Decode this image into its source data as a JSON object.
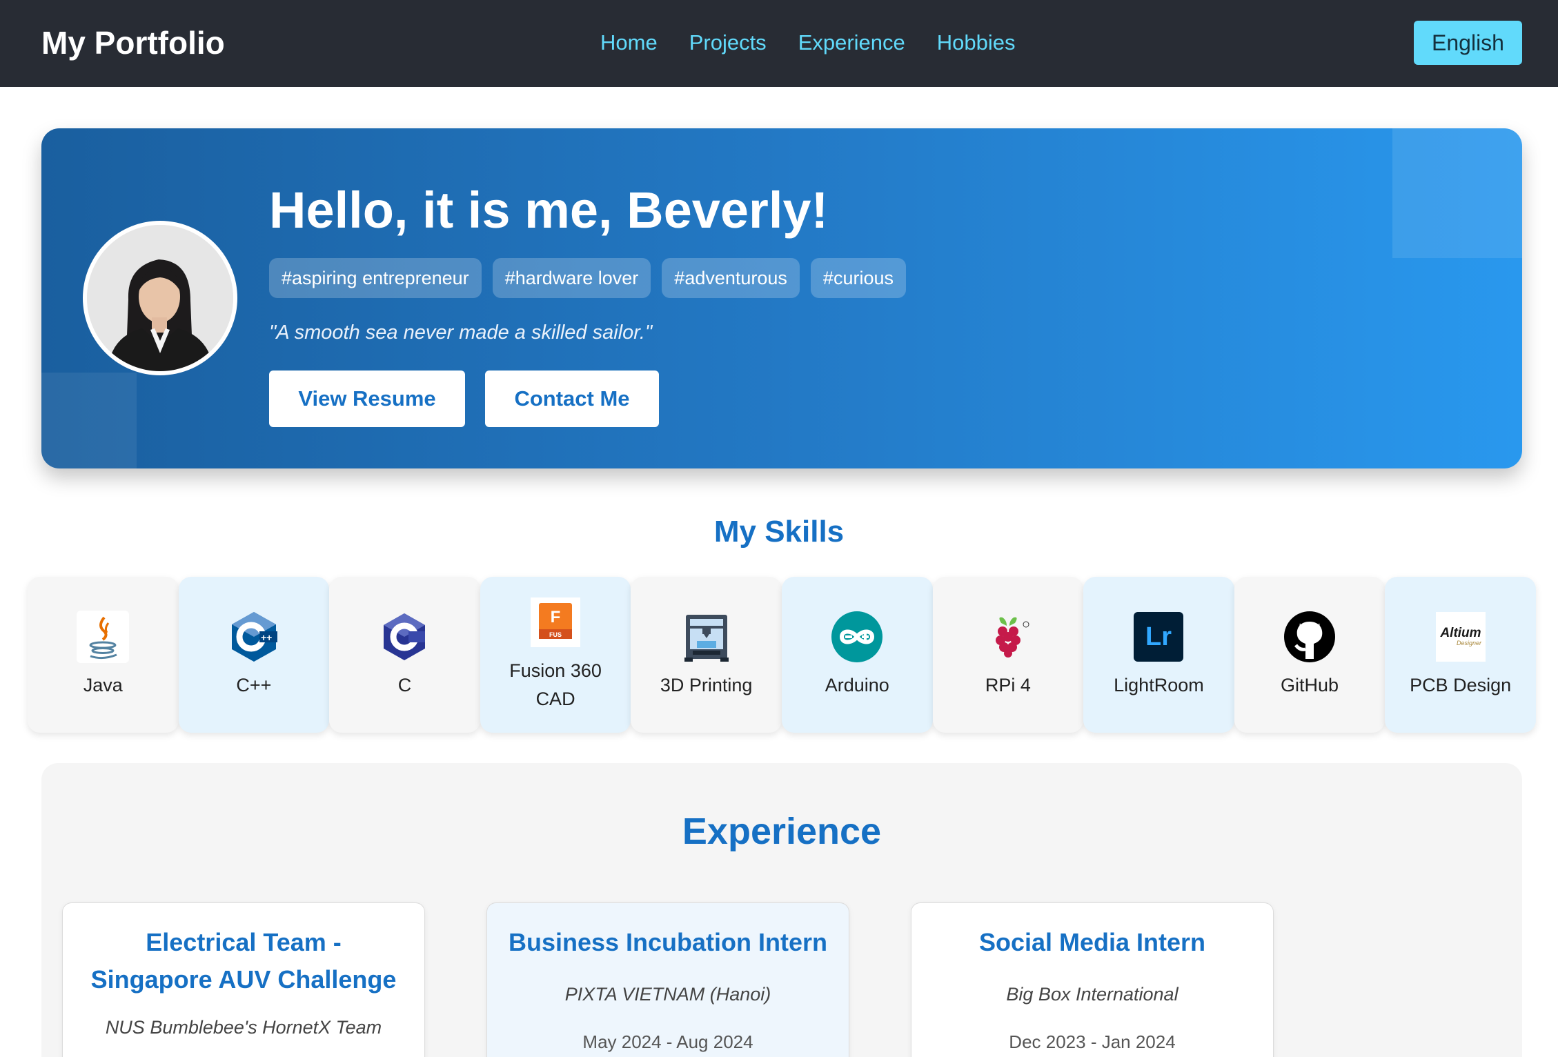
{
  "navbar": {
    "brand": "My Portfolio",
    "links": [
      "Home",
      "Projects",
      "Experience",
      "Hobbies"
    ],
    "language": "English"
  },
  "hero": {
    "title": "Hello, it is me, Beverly!",
    "tags": [
      "#aspiring entrepreneur",
      "#hardware lover",
      "#adventurous",
      "#curious"
    ],
    "quote": "\"A smooth sea never made a skilled sailor.\"",
    "buttons": {
      "resume": "View Resume",
      "contact": "Contact Me"
    }
  },
  "skills": {
    "title": "My Skills",
    "items": [
      {
        "label": "Java",
        "icon": "java-icon"
      },
      {
        "label": "C++",
        "icon": "cplusplus-icon"
      },
      {
        "label": "C",
        "icon": "c-language-icon"
      },
      {
        "label": "Fusion 360 CAD",
        "icon": "fusion360-icon"
      },
      {
        "label": "3D Printing",
        "icon": "3d-printer-icon"
      },
      {
        "label": "Arduino",
        "icon": "arduino-icon"
      },
      {
        "label": "RPi 4",
        "icon": "raspberry-pi-icon"
      },
      {
        "label": "LightRoom",
        "icon": "lightroom-icon"
      },
      {
        "label": "GitHub",
        "icon": "github-icon"
      },
      {
        "label": "PCB Design",
        "icon": "altium-icon"
      }
    ],
    "icon_text": {
      "fusion_letter": "F",
      "fusion_badge": "FUS",
      "lightroom": "Lr",
      "altium": "Altium",
      "altium_sub": "Designer"
    }
  },
  "experience": {
    "title": "Experience",
    "items": [
      {
        "role": "Electrical Team - Singapore AUV Challenge",
        "org": "NUS Bumblebee's HornetX Team",
        "date": ""
      },
      {
        "role": "Business Incubation Intern",
        "org": "PIXTA VIETNAM (Hanoi)",
        "date": "May 2024 - Aug 2024"
      },
      {
        "role": "Social Media Intern",
        "org": "Big Box International",
        "date": "Dec 2023 - Jan 2024"
      }
    ]
  },
  "colors": {
    "navbar_bg": "#282c34",
    "nav_link": "#61dafb",
    "accent_blue": "#1670c4",
    "hero_gradient_start": "#1a5f9f",
    "hero_gradient_end": "#2998ee"
  }
}
